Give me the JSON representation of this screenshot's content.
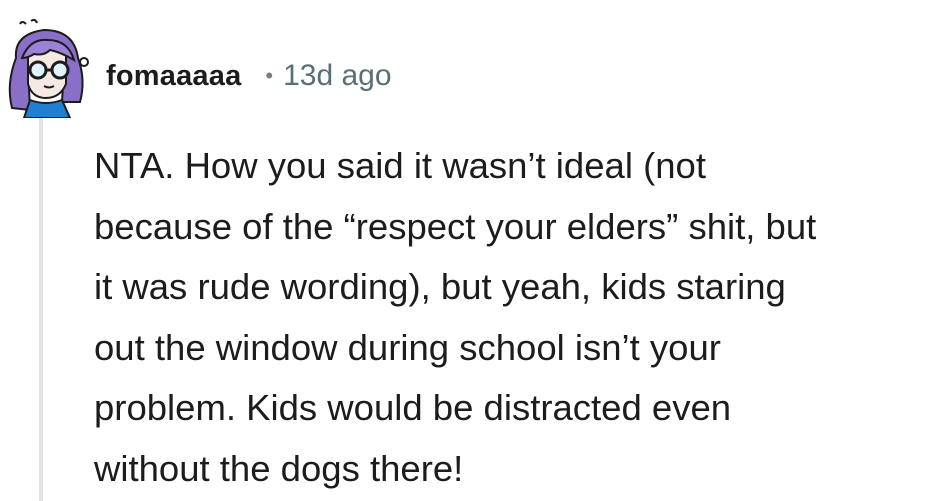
{
  "comment": {
    "username": "fomaaaaa",
    "separator": "•",
    "timestamp": "13d ago",
    "body_lines": [
      "NTA. How you said it wasn’t ideal (not",
      "because of the “respect your elders” shit, but",
      "it was rude wording), but yeah, kids staring",
      "out the window during school isn’t your",
      "problem. Kids would be distracted even",
      "without the dogs there!"
    ]
  },
  "avatar": {
    "icon": "user-avatar-icon",
    "hair_color": "#8a6fc8",
    "shirt_color": "#1f7fd1",
    "background_color": "#ffffff"
  },
  "colors": {
    "text": "#1c1c1c",
    "meta": "#576f76",
    "thread_line": "#e3e6e8"
  }
}
